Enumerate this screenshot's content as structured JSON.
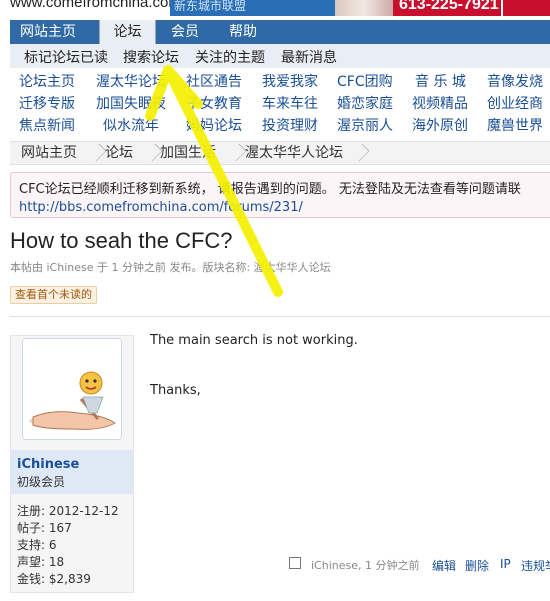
{
  "banner": {
    "site_url": "www.comefromchina.com",
    "ad_text": "新东城市联盟",
    "ad_phone": "613-225-7921",
    "colors": {
      "ad_blue": "#2a6fb5",
      "ad_red": "#c8102e"
    }
  },
  "main_nav": {
    "tabs": [
      {
        "label": "网站主页",
        "active": false
      },
      {
        "label": "论坛",
        "active": true
      },
      {
        "label": "会员",
        "active": false
      },
      {
        "label": "帮助",
        "active": false
      }
    ],
    "color": "#2f6aa6"
  },
  "sub_nav": {
    "items": [
      "标记论坛已读",
      "搜索论坛",
      "关注的主题",
      "最新消息"
    ]
  },
  "forum_links": {
    "rows": [
      [
        "论坛主页",
        "渥太华论坛",
        "社区通告",
        "我爱我家",
        "CFC团购",
        "音 乐 城",
        "音像发烧"
      ],
      [
        "迁移专版",
        "加国失眠夜",
        "子女教育",
        "车来车往",
        "婚恋家庭",
        "视频精品",
        "创业经商"
      ],
      [
        "焦点新闻",
        "似水流年",
        "妈妈论坛",
        "投资理财",
        "渥京丽人",
        "海外原创",
        "魔兽世界"
      ]
    ]
  },
  "breadcrumb": [
    "网站主页",
    "论坛",
    "加国生活",
    "渥太华华人论坛"
  ],
  "notice": {
    "message": "CFC论坛已经顺利迁移到新系统， 请报告遇到的问题。 无法登陆及无法查看等问题请联",
    "link": "http://bbs.comefromchina.com/forums/231/"
  },
  "thread": {
    "title": "How to seah the CFC?",
    "meta": "本帖由 iChinese 于 1 分钟之前 发布。版块名称: 渥太华华人论坛",
    "unread_button": "查看首个未读的"
  },
  "post": {
    "author": "iChinese",
    "rank": "初级会员",
    "stats": [
      {
        "label": "注册",
        "value": "2012-12-12"
      },
      {
        "label": "帖子",
        "value": "167"
      },
      {
        "label": "支持",
        "value": "6"
      },
      {
        "label": "声望",
        "value": "18"
      },
      {
        "label": "金钱",
        "value": "$2,839"
      }
    ],
    "body": [
      "The main search is not working.",
      "Thanks,"
    ],
    "footer_meta": "iChinese, 1 分钟之前",
    "actions": [
      "编辑",
      "删除",
      "IP",
      "违规举报"
    ]
  },
  "annotation_color": "#f5f000"
}
